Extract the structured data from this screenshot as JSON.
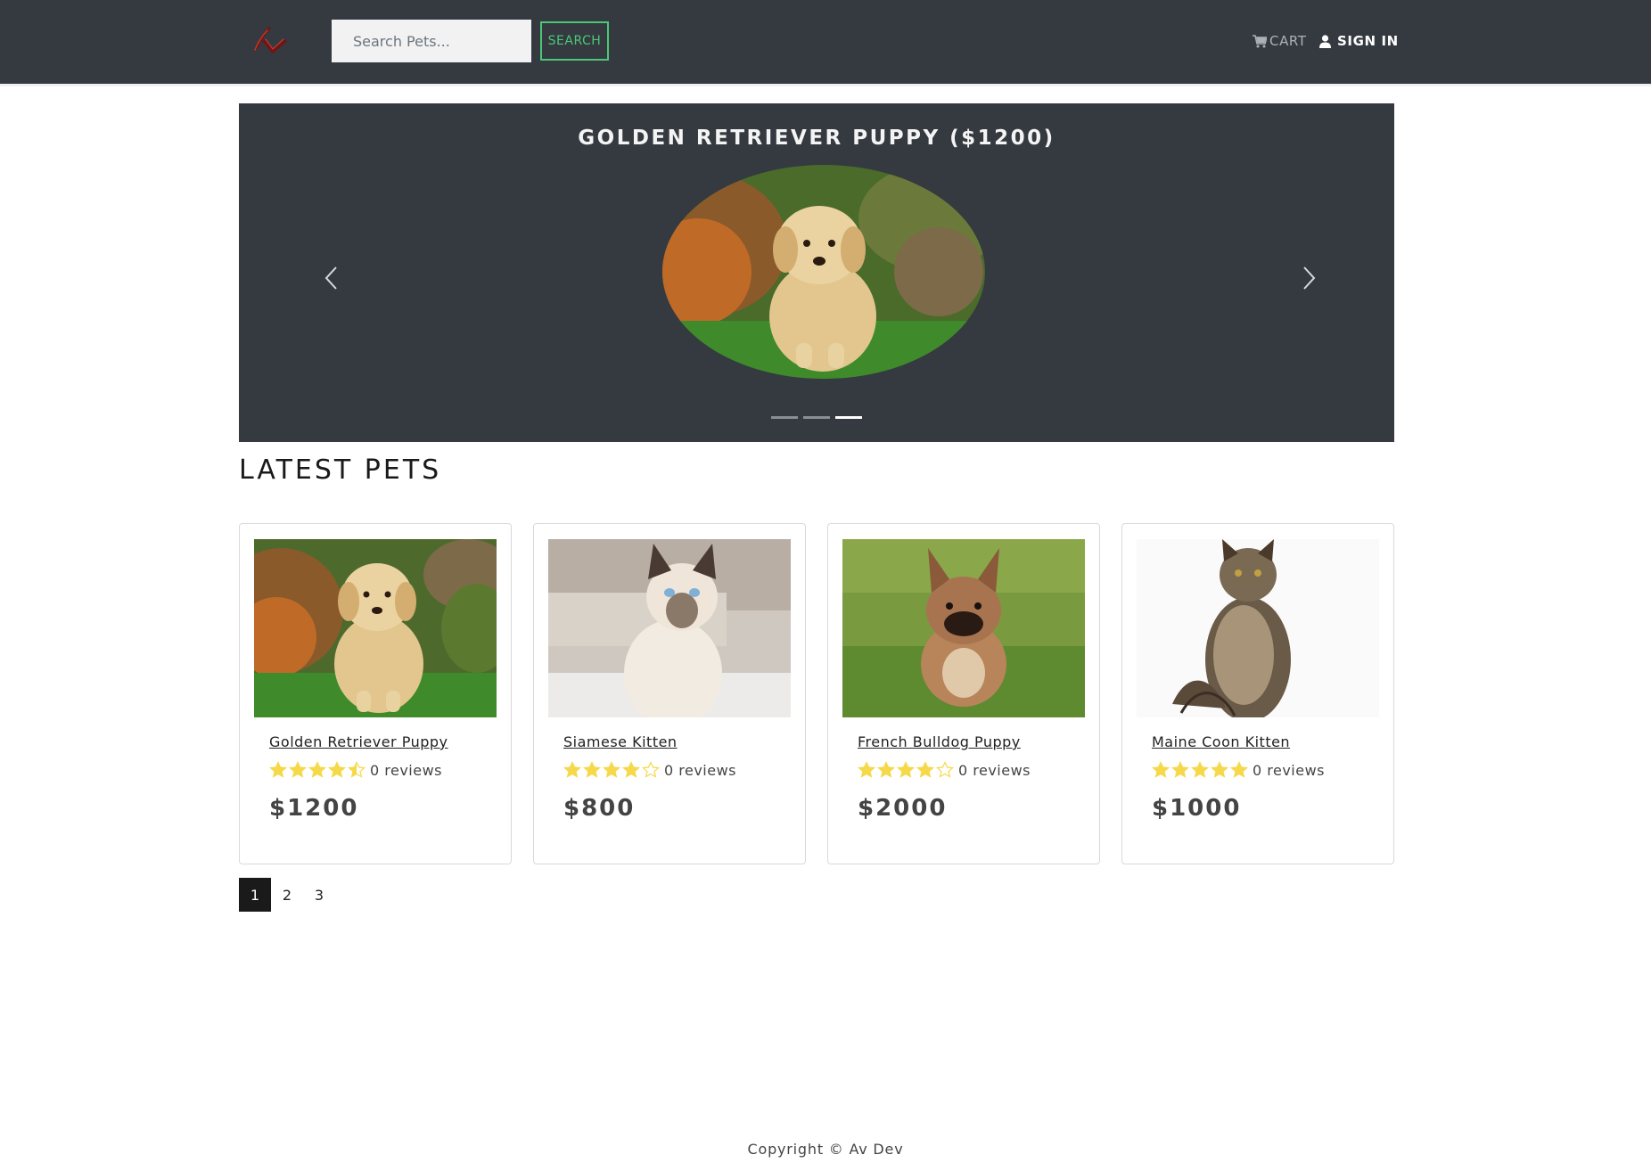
{
  "navbar": {
    "search_placeholder": "Search Pets...",
    "search_label": "SEARCH",
    "cart_label": "CART",
    "signin_label": "SIGN IN"
  },
  "carousel": {
    "title": "GOLDEN RETRIEVER PUPPY ($1200)",
    "slide_count": 3,
    "active_slide": 3
  },
  "section": {
    "title": "LATEST PETS"
  },
  "products": [
    {
      "name": "Golden Retriever Puppy",
      "rating": 4.5,
      "reviews": "0 reviews",
      "price": "$1200",
      "image": "golden-retriever-puppy-photo"
    },
    {
      "name": "Siamese Kitten",
      "rating": 4,
      "reviews": "0 reviews",
      "price": "$800",
      "image": "siamese-kitten-photo"
    },
    {
      "name": "French Bulldog Puppy",
      "rating": 4,
      "reviews": "0 reviews",
      "price": "$2000",
      "image": "french-bulldog-puppy-photo"
    },
    {
      "name": "Maine Coon Kitten",
      "rating": 5,
      "reviews": "0 reviews",
      "price": "$1000",
      "image": "maine-coon-kitten-photo"
    }
  ],
  "pagination": {
    "pages": [
      "1",
      "2",
      "3"
    ],
    "active": "1"
  },
  "footer": {
    "text": "Copyright © Av Dev"
  },
  "colors": {
    "navbar": "#343a40",
    "search_accent": "#4cc777",
    "star": "#f5d94a"
  }
}
